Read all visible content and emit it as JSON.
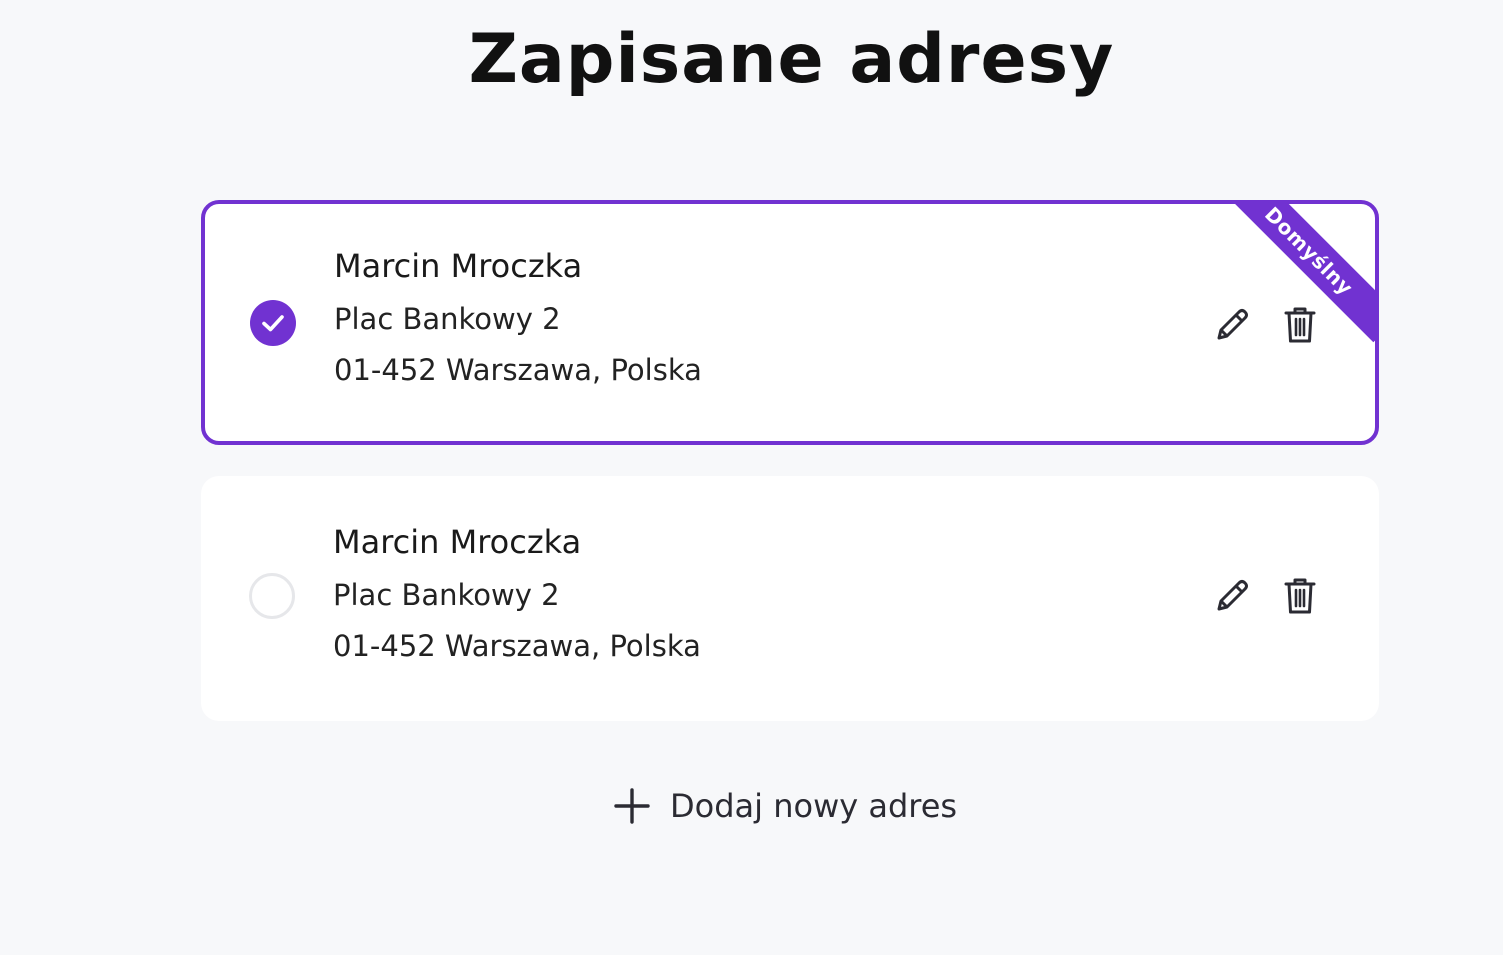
{
  "page": {
    "title": "Zapisane adresy"
  },
  "addresses": [
    {
      "name": "Marcin Mroczka",
      "street": "Plac Bankowy 2",
      "city_line": "01-452 Warszawa, Polska",
      "selected": true,
      "badge": "Domyślny"
    },
    {
      "name": "Marcin Mroczka",
      "street": "Plac Bankowy 2",
      "city_line": "01-452 Warszawa, Polska",
      "selected": false
    }
  ],
  "icons": {
    "radio_checked": "check-icon",
    "edit": "pencil-icon",
    "delete": "trash-icon",
    "add": "plus-icon"
  },
  "add_button": {
    "label": "Dodaj nowy adres"
  },
  "colors": {
    "accent": "#7132d1",
    "background": "#f7f8fa",
    "card": "#ffffff",
    "radio_unchecked_border": "#e6e7ea"
  }
}
